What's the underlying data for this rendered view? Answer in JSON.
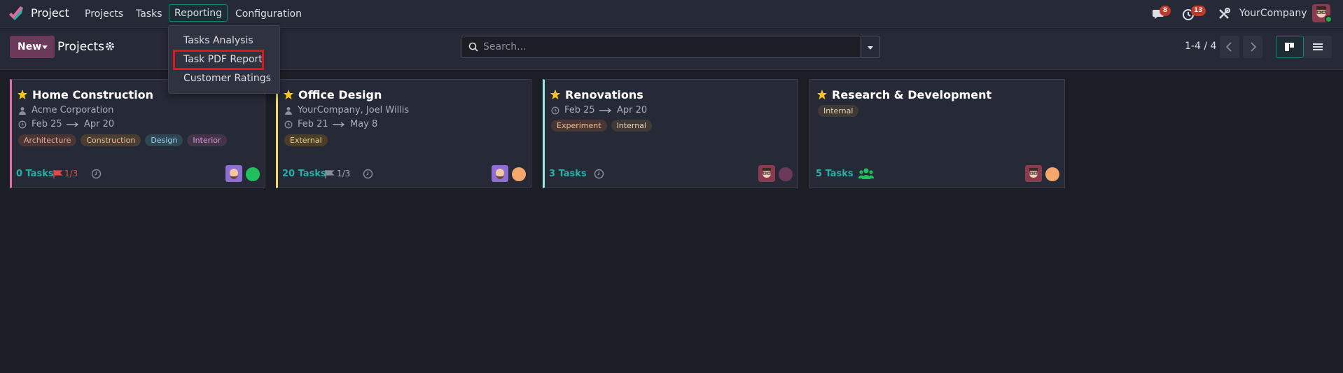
{
  "navbar": {
    "app_title": "Project",
    "menu": [
      "Projects",
      "Tasks",
      "Reporting",
      "Configuration"
    ],
    "active_menu": "Reporting",
    "messages_count": "8",
    "activities_count": "13",
    "company": "YourCompany"
  },
  "reporting_menu": {
    "items": [
      "Tasks Analysis",
      "Task PDF Report",
      "Customer Ratings"
    ],
    "highlighted": "Task PDF Report"
  },
  "control_panel": {
    "new_label": "New",
    "title": "Projects",
    "search_placeholder": "Search...",
    "pager": "1-4 / 4",
    "active_view": "kanban"
  },
  "projects": [
    {
      "name": "Home Construction",
      "customer": "Acme Corporation",
      "date_start": "Feb 25",
      "date_end": "Apr 20",
      "tags": [
        "Architecture",
        "Construction",
        "Design",
        "Interior"
      ],
      "tasks": "0 Tasks",
      "milestones": "1/3",
      "color": "#e36fa6",
      "status_color": "#21c05e"
    },
    {
      "name": "Office Design",
      "customer": "YourCompany, Joel Willis",
      "date_start": "Feb 21",
      "date_end": "May 8",
      "tags": [
        "External"
      ],
      "tasks": "20 Tasks",
      "milestones": "1/3",
      "color": "#f5d76e",
      "status_color": "#f4a76a"
    },
    {
      "name": "Renovations",
      "customer": "",
      "date_start": "Feb 25",
      "date_end": "Apr 20",
      "tags": [
        "Experiment",
        "Internal"
      ],
      "tasks": "3 Tasks",
      "milestones": "",
      "color": "#9fe7e3",
      "status_color": "#6b3a5b"
    },
    {
      "name": "Research & Development",
      "customer": "",
      "date_start": "",
      "date_end": "",
      "tags": [
        "Internal"
      ],
      "tasks": "5 Tasks",
      "milestones": "",
      "color": "#3a3e4b",
      "status_color": "#f4a76a"
    }
  ],
  "colors": {
    "accent": "#0e8a7d",
    "primary": "#6b3a5b",
    "task_link": "#26b0a6",
    "danger_flag": "#e24a4a"
  }
}
